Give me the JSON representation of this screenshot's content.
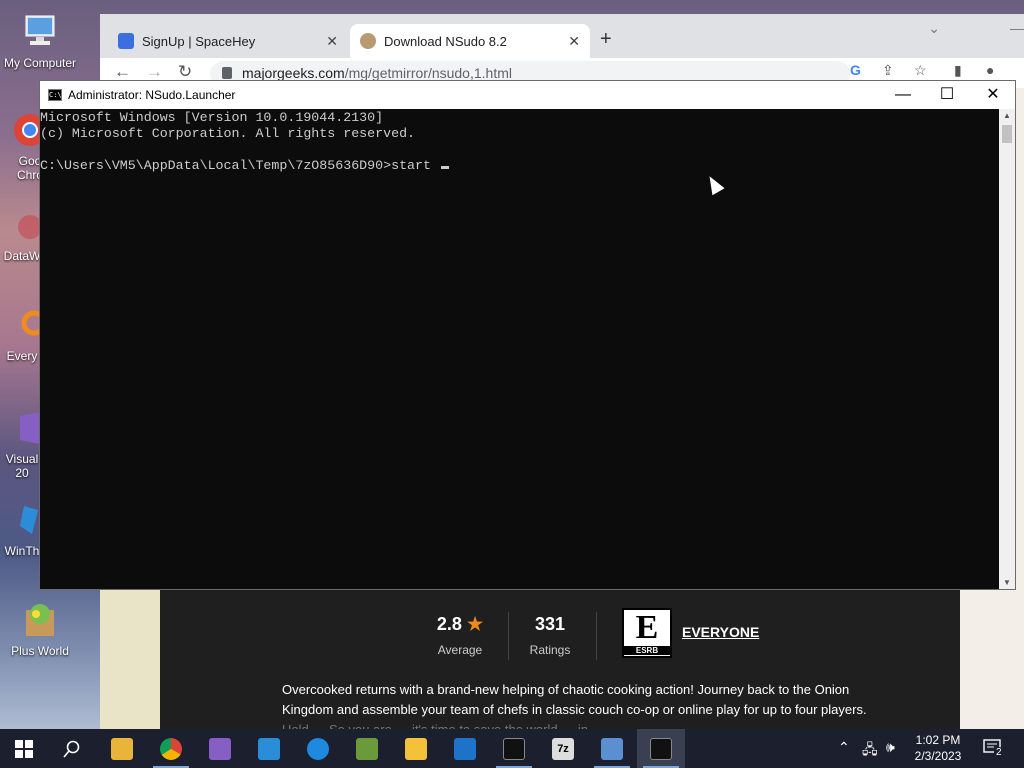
{
  "desktop": {
    "icons": [
      {
        "label": "My Computer"
      },
      {
        "label": "Goo Chro"
      },
      {
        "label": "DataW"
      },
      {
        "label": "Every"
      },
      {
        "label": "Visual 20"
      },
      {
        "label": "WinTh"
      },
      {
        "label": "Plus World"
      }
    ]
  },
  "browser": {
    "tabs": [
      {
        "title": "SignUp | SpaceHey",
        "icon": "spacehey-icon"
      },
      {
        "title": "Download NSudo 8.2",
        "icon": "majorgeeks-icon"
      }
    ],
    "new_tab": "+",
    "url_host": "majorgeeks.com",
    "url_path": "/mg/getmirror/nsudo,1.html",
    "app": {
      "rating_value": "2.8",
      "rating_label": "Average",
      "ratings_count": "331",
      "ratings_label": "Ratings",
      "esrb_letter": "E",
      "esrb_text": "ESRB",
      "esrb_rating": "EVERYONE",
      "description_line1": "Overcooked returns with a brand-new helping of chaotic cooking action! Journey back to the Onion",
      "description_line2": "Kingdom and assemble your team of chefs in classic couch co-op or online play for up to four players.",
      "description_line3": "Hold … So you are … it's time to save the world … in …"
    }
  },
  "cmd": {
    "title": "Administrator: NSudo.Launcher",
    "line1": "Microsoft Windows [Version 10.0.19044.2130]",
    "line2": "(c) Microsoft Corporation. All rights reserved.",
    "line3": "",
    "prompt": "C:\\Users\\VM5\\AppData\\Local\\Temp\\7zO85636D90>start "
  },
  "taskbar": {
    "time": "1:02 PM",
    "date": "2/3/2023",
    "notification_count": "2",
    "items": [
      "start",
      "search",
      "file-explorer",
      "chrome",
      "visual-studio",
      "winthing",
      "internet-explorer",
      "people",
      "store",
      "mail",
      "cmd",
      "7zip",
      "remote-desktop",
      "cmd-active"
    ]
  },
  "colors": {
    "cmd_bg": "#0c0c0c",
    "cmd_fg": "#cccccc",
    "taskbar": "#1b1f2e",
    "panel": "#1f1f1f"
  }
}
